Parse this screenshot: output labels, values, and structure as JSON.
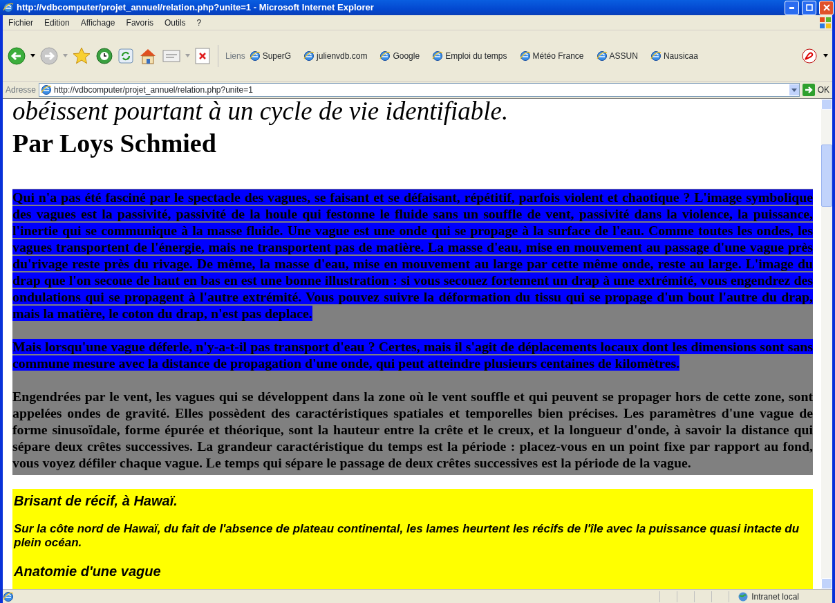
{
  "window": {
    "title": "http://vdbcomputer/projet_annuel/relation.php?unite=1 - Microsoft Internet Explorer"
  },
  "menu": [
    "Fichier",
    "Edition",
    "Affichage",
    "Favoris",
    "Outils",
    "?"
  ],
  "toolbar": {
    "links_label": "Liens",
    "links": [
      "SuperG",
      "julienvdb.com",
      "Google",
      "Emploi du temps",
      "Météo France",
      "ASSUN",
      "Nausicaa"
    ]
  },
  "address_bar": {
    "label": "Adresse",
    "value": "http://vdbcomputer/projet_annuel/relation.php?unite=1",
    "go": "OK"
  },
  "page": {
    "cut_top_line": "obéissent pourtant à un cycle de vie identifiable.",
    "author": "Par Loys Schmied",
    "paragraphs": [
      {
        "text": "Qui n'a pas été fasciné par le spectacle des vagues, se faisant et se défaisant, répétitif, parfois violent et chaotique ? L'image symbolique des vagues est la passivité, passivité de la houle qui festonne le fluide sans un souffle de vent, passivité dans la violence, la puissance, l'inertie qui se communique à la masse fluide. Une vague est une onde qui se propage à la surface de l'eau. Comme toutes les ondes, les vagues transportent de l'énergie, mais ne transportent pas de matière. La masse d'eau, mise en mouvement au passage d'une vague près du'rivage reste près du rivage. De même, la masse d'eau, mise en mouvement au large par cette même onde, reste au large. L'image du drap que l'on secoue de haut en bas en est une bonne illustration : si vous secouez fortement un drap à une extrémité, vous engendrez des ondulations qui se propagent à l'autre extrémité. Vous pouvez suivre la déformation du tissu qui se propage d'un bout l'autre du drap, mais la matière, le coton du drap, n'est pas deplace.",
        "highlighted": true
      },
      {
        "text": "Mais lorsqu'une vague déferle, n'y-a-t-il pas transport d'eau ? Certes, mais il s'agit de déplacements locaux dont les dimensions sont sans commune mesure avec la distance de propagation d'une onde, qui peut atteindre plusieurs centaines de kilomètres.",
        "highlighted": true
      },
      {
        "text": "Engendrées par le vent, les vagues qui se développent dans la zone où le vent souffle et qui peuvent se propager hors de cette zone, sont appelées ondes de gravité. Elles possèdent des caractéristiques spatiales et temporelles bien précises. Les paramètres d'une vague de forme sinusoïdale, forme épurée et théorique, sont la hauteur entre la crête et le creux, et la longueur d'onde, à savoir la distance qui sépare deux crêtes successives. La grandeur caractéristique du temps est la période : placez-vous en un point fixe par rapport au fond, vous voyez défiler chaque vague. Le temps qui sépare le passage de deux crêtes successives est la période de la vague.",
        "highlighted": false
      }
    ],
    "caption_box": {
      "title": "Brisant de récif, à Hawaï.",
      "text": "Sur la côte nord de Hawaï, du fait de l'absence de plateau continental, les lames heurtent les récifs de l'île avec la puissance quasi intacte du plein océan.",
      "cut_heading": "Anatomie d'une vague"
    }
  },
  "status_bar": {
    "zone": "Intranet local"
  }
}
